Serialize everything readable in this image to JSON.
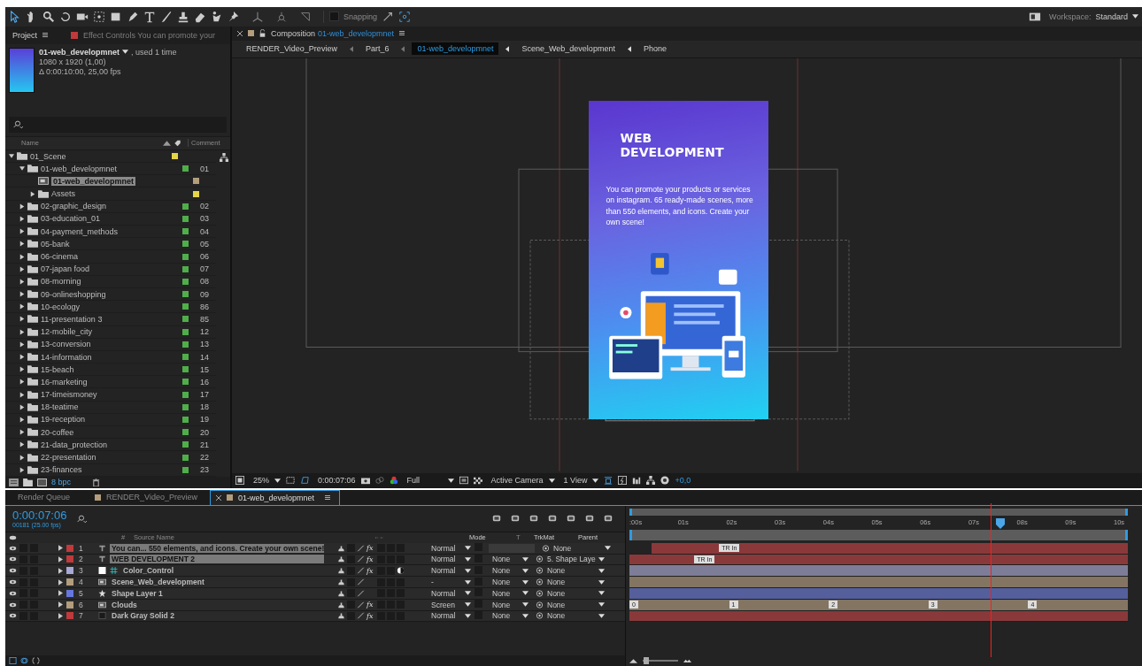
{
  "toolbar": {
    "snapping": {
      "label": "Snapping",
      "checked": false
    },
    "workspace_label": "Workspace:",
    "workspace": "Standard"
  },
  "project_panel": {
    "tabs": [
      {
        "label": "Project",
        "selected": true
      },
      {
        "label": "Effect Controls You can promote your",
        "selected": false
      }
    ],
    "item": {
      "name": "01-web_developmnet",
      "usage": ", used 1 time",
      "size": "1080 x 1920 (1,00)",
      "duration": "Δ 0:00:10:00, 25,00 fps"
    },
    "columns": [
      "Name",
      "Comment"
    ],
    "tree": [
      {
        "label": "01_Scene",
        "kind": "folder",
        "expanded": true,
        "selected": false,
        "color": "#e3d548",
        "children": [
          {
            "label": "01-web_developmnet",
            "kind": "folder",
            "expanded": true,
            "selected": false,
            "color": "#4fae4a",
            "comment": "01",
            "children": [
              {
                "label": "01-web_developmnet",
                "kind": "comp",
                "selected": true,
                "color": "#b39d7c"
              },
              {
                "label": "Assets",
                "kind": "folder",
                "expanded": false,
                "selected": false,
                "color": "#e3d548"
              }
            ]
          },
          {
            "label": "02-graphic_design",
            "kind": "folder",
            "expanded": false,
            "selected": false,
            "color": "#4fae4a",
            "comment": "02"
          },
          {
            "label": "03-education_01",
            "kind": "folder",
            "expanded": false,
            "selected": false,
            "color": "#4fae4a",
            "comment": "03"
          },
          {
            "label": "04-payment_methods",
            "kind": "folder",
            "expanded": false,
            "selected": false,
            "color": "#4fae4a",
            "comment": "04"
          },
          {
            "label": "05-bank",
            "kind": "folder",
            "expanded": false,
            "selected": false,
            "color": "#4fae4a",
            "comment": "05"
          },
          {
            "label": "06-cinema",
            "kind": "folder",
            "expanded": false,
            "selected": false,
            "color": "#4fae4a",
            "comment": "06"
          },
          {
            "label": "07-japan food",
            "kind": "folder",
            "expanded": false,
            "selected": false,
            "color": "#4fae4a",
            "comment": "07"
          },
          {
            "label": "08-morning",
            "kind": "folder",
            "expanded": false,
            "selected": false,
            "color": "#4fae4a",
            "comment": "08"
          },
          {
            "label": "09-onlineshopping",
            "kind": "folder",
            "expanded": false,
            "selected": false,
            "color": "#4fae4a",
            "comment": "09"
          },
          {
            "label": "10-ecology",
            "kind": "folder",
            "expanded": false,
            "selected": false,
            "color": "#4fae4a",
            "comment": "86"
          },
          {
            "label": "11-presentation 3",
            "kind": "folder",
            "expanded": false,
            "selected": false,
            "color": "#4fae4a",
            "comment": "85"
          },
          {
            "label": "12-mobile_city",
            "kind": "folder",
            "expanded": false,
            "selected": false,
            "color": "#4fae4a",
            "comment": "12"
          },
          {
            "label": "13-conversion",
            "kind": "folder",
            "expanded": false,
            "selected": false,
            "color": "#4fae4a",
            "comment": "13"
          },
          {
            "label": "14-information",
            "kind": "folder",
            "expanded": false,
            "selected": false,
            "color": "#4fae4a",
            "comment": "14"
          },
          {
            "label": "15-beach",
            "kind": "folder",
            "expanded": false,
            "selected": false,
            "color": "#4fae4a",
            "comment": "15"
          },
          {
            "label": "16-marketing",
            "kind": "folder",
            "expanded": false,
            "selected": false,
            "color": "#4fae4a",
            "comment": "16"
          },
          {
            "label": "17-timeismoney",
            "kind": "folder",
            "expanded": false,
            "selected": false,
            "color": "#4fae4a",
            "comment": "17"
          },
          {
            "label": "18-teatime",
            "kind": "folder",
            "expanded": false,
            "selected": false,
            "color": "#4fae4a",
            "comment": "18"
          },
          {
            "label": "19-reception",
            "kind": "folder",
            "expanded": false,
            "selected": false,
            "color": "#4fae4a",
            "comment": "19"
          },
          {
            "label": "20-coffee",
            "kind": "folder",
            "expanded": false,
            "selected": false,
            "color": "#4fae4a",
            "comment": "20"
          },
          {
            "label": "21-data_protection",
            "kind": "folder",
            "expanded": false,
            "selected": false,
            "color": "#4fae4a",
            "comment": "21"
          },
          {
            "label": "22-presentation",
            "kind": "folder",
            "expanded": false,
            "selected": false,
            "color": "#4fae4a",
            "comment": "22"
          },
          {
            "label": "23-finances",
            "kind": "folder",
            "expanded": false,
            "selected": false,
            "color": "#4fae4a",
            "comment": "23"
          }
        ]
      }
    ],
    "bpc": "8 bpc"
  },
  "composition_panel": {
    "tab_label": "Composition",
    "comp_name": "01-web_developmnet",
    "breadcrumbs": [
      {
        "label": "RENDER_Video_Preview",
        "selected": false
      },
      {
        "label": "Part_6",
        "selected": false
      },
      {
        "label": "01-web_developmnet",
        "selected": true
      },
      {
        "label": "Scene_Web_development",
        "selected": false
      },
      {
        "label": "Phone",
        "selected": false
      }
    ],
    "preview": {
      "heading": "WEB DEVELOPMENT",
      "body": "You can promote your products or services on instagram. 65 ready-made scenes, more than 550 elements, and icons. Create your own scene!"
    },
    "viewer_bar": {
      "zoom": "25%",
      "time": "0:00:07:06",
      "resolution": "Full",
      "camera": "Active Camera",
      "views": "1 View",
      "exposure": "+0,0"
    }
  },
  "timeline": {
    "tabs": [
      {
        "label": "Render Queue",
        "selected": false
      },
      {
        "label": "RENDER_Video_Preview",
        "selected": false,
        "color": "#b39d7c"
      },
      {
        "label": "01-web_developmnet",
        "selected": true,
        "color": "#b39d7c"
      }
    ],
    "current_time": "0:00:07:06",
    "frame_info": "00181 (25.00 fps)",
    "columns": {
      "number": "#",
      "source": "Source Name",
      "mode": "Mode",
      "t": "T",
      "trkmat": "TrkMat",
      "parent": "Parent"
    },
    "ruler": [
      ":00s",
      "01s",
      "02s",
      "03s",
      "04s",
      "05s",
      "06s",
      "07s",
      "08s",
      "09s",
      "10s"
    ],
    "playhead": {
      "level": 0.725
    },
    "zoom_slider": {
      "level": 0.1
    },
    "layers": [
      {
        "index": "1",
        "name": "You can... 550 elements, and icons. Create your own scene!",
        "kind": "text",
        "color": "#c0393b",
        "selected": true,
        "fx": "fx",
        "mode": "Normal",
        "parent": "None",
        "bar": {
          "level": 0.955
        },
        "markers": [
          {
            "label": "TR In",
            "level": 0.18
          }
        ]
      },
      {
        "index": "2",
        "name": "WEB DEVELOPMENT 2",
        "kind": "text",
        "color": "#c0393b",
        "selected": true,
        "fx": "fx",
        "mode": "Normal",
        "trkmat": "None",
        "parent": "5. Shape Laye",
        "bar": {
          "level": 1
        },
        "markers": [
          {
            "label": "TR In",
            "level": 0.13
          }
        ]
      },
      {
        "index": "3",
        "name": "Color_Control",
        "kind": "adjustment",
        "color": "#a9a9d6",
        "selected": false,
        "fx": "fx",
        "mode": "Normal",
        "trkmat": "None",
        "parent": "None",
        "bar": {
          "level": 1
        }
      },
      {
        "index": "4",
        "name": "Scene_Web_development",
        "kind": "comp",
        "color": "#b39d7c",
        "selected": false,
        "mode": "-",
        "trkmat": "None",
        "parent": "None",
        "bar": {
          "level": 1
        }
      },
      {
        "index": "5",
        "name": "Shape Layer 1",
        "kind": "shape",
        "color": "#6677dd",
        "selected": false,
        "mode": "Normal",
        "trkmat": "None",
        "parent": "None",
        "bar": {
          "level": 1
        }
      },
      {
        "index": "6",
        "name": "Clouds",
        "kind": "comp",
        "color": "#b39d7c",
        "selected": false,
        "fx": "fx",
        "mode": "Screen",
        "trkmat": "None",
        "parent": "None",
        "bar": {
          "level": 1
        },
        "markers": [
          {
            "label": "0",
            "level": 0
          },
          {
            "label": "1",
            "level": 0.2
          },
          {
            "label": "2",
            "level": 0.4
          },
          {
            "label": "3",
            "level": 0.6
          },
          {
            "label": "4",
            "level": 0.8
          }
        ]
      },
      {
        "index": "7",
        "name": "Dark Gray Solid 2",
        "kind": "solid",
        "color": "#c0393b",
        "selected": false,
        "fx": "fx",
        "mode": "Normal",
        "trkmat": "None",
        "parent": "None",
        "bar": {
          "level": 1
        }
      }
    ]
  }
}
